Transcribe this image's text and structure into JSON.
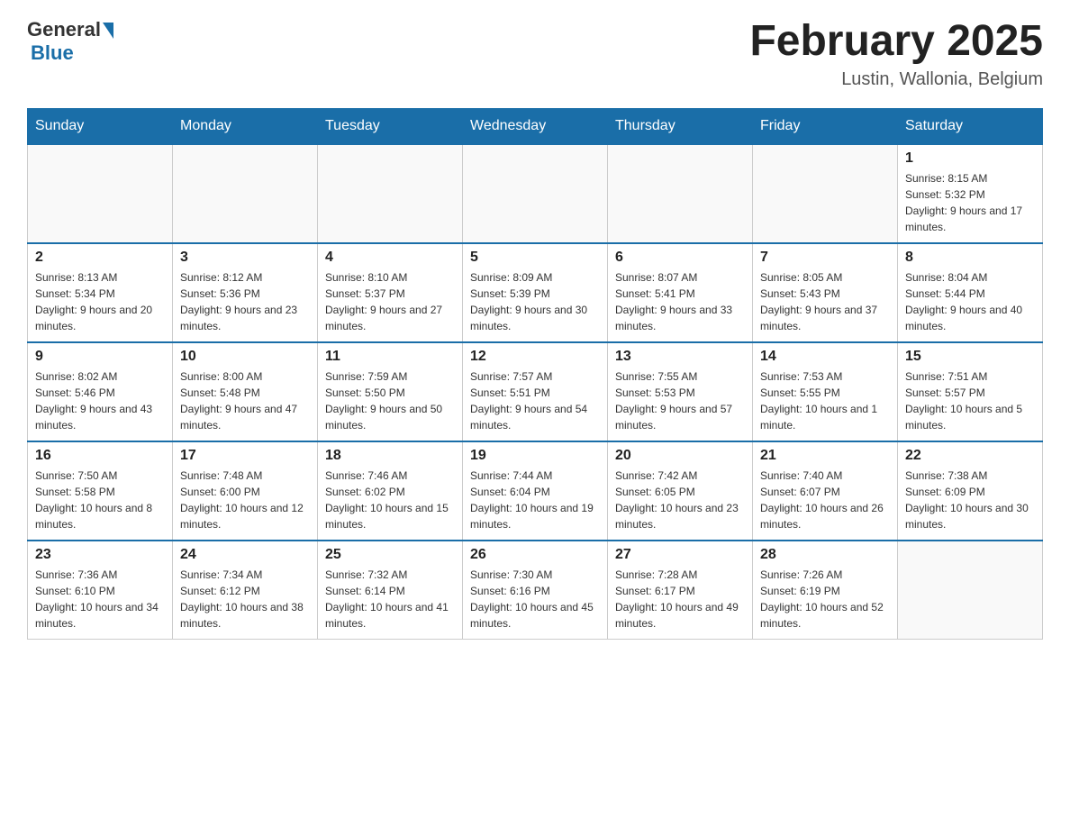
{
  "header": {
    "logo": {
      "text_general": "General",
      "text_blue": "Blue"
    },
    "title": "February 2025",
    "location": "Lustin, Wallonia, Belgium"
  },
  "weekdays": [
    "Sunday",
    "Monday",
    "Tuesday",
    "Wednesday",
    "Thursday",
    "Friday",
    "Saturday"
  ],
  "weeks": [
    [
      {
        "day": "",
        "sunrise": "",
        "sunset": "",
        "daylight": ""
      },
      {
        "day": "",
        "sunrise": "",
        "sunset": "",
        "daylight": ""
      },
      {
        "day": "",
        "sunrise": "",
        "sunset": "",
        "daylight": ""
      },
      {
        "day": "",
        "sunrise": "",
        "sunset": "",
        "daylight": ""
      },
      {
        "day": "",
        "sunrise": "",
        "sunset": "",
        "daylight": ""
      },
      {
        "day": "",
        "sunrise": "",
        "sunset": "",
        "daylight": ""
      },
      {
        "day": "1",
        "sunrise": "Sunrise: 8:15 AM",
        "sunset": "Sunset: 5:32 PM",
        "daylight": "Daylight: 9 hours and 17 minutes."
      }
    ],
    [
      {
        "day": "2",
        "sunrise": "Sunrise: 8:13 AM",
        "sunset": "Sunset: 5:34 PM",
        "daylight": "Daylight: 9 hours and 20 minutes."
      },
      {
        "day": "3",
        "sunrise": "Sunrise: 8:12 AM",
        "sunset": "Sunset: 5:36 PM",
        "daylight": "Daylight: 9 hours and 23 minutes."
      },
      {
        "day": "4",
        "sunrise": "Sunrise: 8:10 AM",
        "sunset": "Sunset: 5:37 PM",
        "daylight": "Daylight: 9 hours and 27 minutes."
      },
      {
        "day": "5",
        "sunrise": "Sunrise: 8:09 AM",
        "sunset": "Sunset: 5:39 PM",
        "daylight": "Daylight: 9 hours and 30 minutes."
      },
      {
        "day": "6",
        "sunrise": "Sunrise: 8:07 AM",
        "sunset": "Sunset: 5:41 PM",
        "daylight": "Daylight: 9 hours and 33 minutes."
      },
      {
        "day": "7",
        "sunrise": "Sunrise: 8:05 AM",
        "sunset": "Sunset: 5:43 PM",
        "daylight": "Daylight: 9 hours and 37 minutes."
      },
      {
        "day": "8",
        "sunrise": "Sunrise: 8:04 AM",
        "sunset": "Sunset: 5:44 PM",
        "daylight": "Daylight: 9 hours and 40 minutes."
      }
    ],
    [
      {
        "day": "9",
        "sunrise": "Sunrise: 8:02 AM",
        "sunset": "Sunset: 5:46 PM",
        "daylight": "Daylight: 9 hours and 43 minutes."
      },
      {
        "day": "10",
        "sunrise": "Sunrise: 8:00 AM",
        "sunset": "Sunset: 5:48 PM",
        "daylight": "Daylight: 9 hours and 47 minutes."
      },
      {
        "day": "11",
        "sunrise": "Sunrise: 7:59 AM",
        "sunset": "Sunset: 5:50 PM",
        "daylight": "Daylight: 9 hours and 50 minutes."
      },
      {
        "day": "12",
        "sunrise": "Sunrise: 7:57 AM",
        "sunset": "Sunset: 5:51 PM",
        "daylight": "Daylight: 9 hours and 54 minutes."
      },
      {
        "day": "13",
        "sunrise": "Sunrise: 7:55 AM",
        "sunset": "Sunset: 5:53 PM",
        "daylight": "Daylight: 9 hours and 57 minutes."
      },
      {
        "day": "14",
        "sunrise": "Sunrise: 7:53 AM",
        "sunset": "Sunset: 5:55 PM",
        "daylight": "Daylight: 10 hours and 1 minute."
      },
      {
        "day": "15",
        "sunrise": "Sunrise: 7:51 AM",
        "sunset": "Sunset: 5:57 PM",
        "daylight": "Daylight: 10 hours and 5 minutes."
      }
    ],
    [
      {
        "day": "16",
        "sunrise": "Sunrise: 7:50 AM",
        "sunset": "Sunset: 5:58 PM",
        "daylight": "Daylight: 10 hours and 8 minutes."
      },
      {
        "day": "17",
        "sunrise": "Sunrise: 7:48 AM",
        "sunset": "Sunset: 6:00 PM",
        "daylight": "Daylight: 10 hours and 12 minutes."
      },
      {
        "day": "18",
        "sunrise": "Sunrise: 7:46 AM",
        "sunset": "Sunset: 6:02 PM",
        "daylight": "Daylight: 10 hours and 15 minutes."
      },
      {
        "day": "19",
        "sunrise": "Sunrise: 7:44 AM",
        "sunset": "Sunset: 6:04 PM",
        "daylight": "Daylight: 10 hours and 19 minutes."
      },
      {
        "day": "20",
        "sunrise": "Sunrise: 7:42 AM",
        "sunset": "Sunset: 6:05 PM",
        "daylight": "Daylight: 10 hours and 23 minutes."
      },
      {
        "day": "21",
        "sunrise": "Sunrise: 7:40 AM",
        "sunset": "Sunset: 6:07 PM",
        "daylight": "Daylight: 10 hours and 26 minutes."
      },
      {
        "day": "22",
        "sunrise": "Sunrise: 7:38 AM",
        "sunset": "Sunset: 6:09 PM",
        "daylight": "Daylight: 10 hours and 30 minutes."
      }
    ],
    [
      {
        "day": "23",
        "sunrise": "Sunrise: 7:36 AM",
        "sunset": "Sunset: 6:10 PM",
        "daylight": "Daylight: 10 hours and 34 minutes."
      },
      {
        "day": "24",
        "sunrise": "Sunrise: 7:34 AM",
        "sunset": "Sunset: 6:12 PM",
        "daylight": "Daylight: 10 hours and 38 minutes."
      },
      {
        "day": "25",
        "sunrise": "Sunrise: 7:32 AM",
        "sunset": "Sunset: 6:14 PM",
        "daylight": "Daylight: 10 hours and 41 minutes."
      },
      {
        "day": "26",
        "sunrise": "Sunrise: 7:30 AM",
        "sunset": "Sunset: 6:16 PM",
        "daylight": "Daylight: 10 hours and 45 minutes."
      },
      {
        "day": "27",
        "sunrise": "Sunrise: 7:28 AM",
        "sunset": "Sunset: 6:17 PM",
        "daylight": "Daylight: 10 hours and 49 minutes."
      },
      {
        "day": "28",
        "sunrise": "Sunrise: 7:26 AM",
        "sunset": "Sunset: 6:19 PM",
        "daylight": "Daylight: 10 hours and 52 minutes."
      },
      {
        "day": "",
        "sunrise": "",
        "sunset": "",
        "daylight": ""
      }
    ]
  ]
}
